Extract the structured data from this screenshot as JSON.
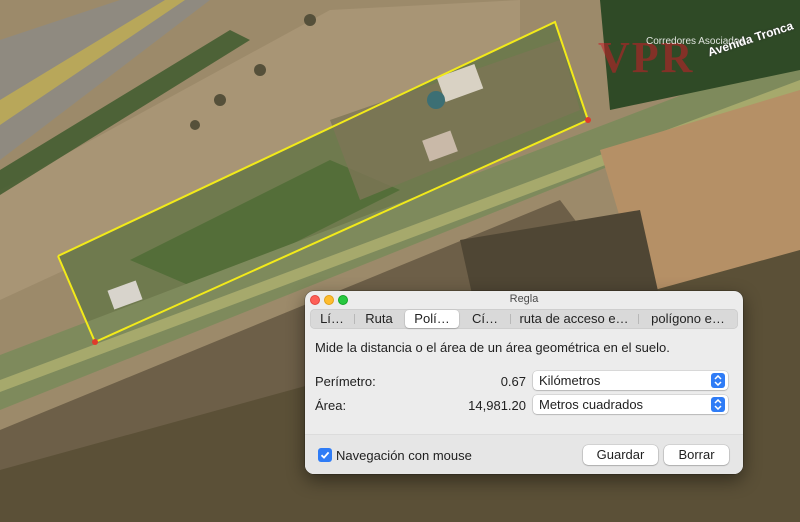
{
  "map": {
    "watermark_logo": "VPR",
    "watermark_text": "Corredores Asociados",
    "road_label": "Avenida Tronca"
  },
  "window": {
    "title": "Regla",
    "tabs": [
      {
        "label": "Lí…",
        "active": false
      },
      {
        "label": "Ruta",
        "active": false
      },
      {
        "label": "Polí…",
        "active": true
      },
      {
        "label": "Cí…",
        "active": false
      },
      {
        "label": "ruta de acceso e…",
        "active": false
      },
      {
        "label": "polígono e…",
        "active": false
      }
    ],
    "description": "Mide la distancia o el área de un área geométrica en el suelo.",
    "perimeter": {
      "label": "Perímetro:",
      "value": "0.67",
      "unit": "Kilómetros"
    },
    "area": {
      "label": "Área:",
      "value": "14,981.20",
      "unit": "Metros cuadrados"
    },
    "mouse_nav": {
      "label": "Navegación con mouse",
      "checked": true
    },
    "save_label": "Guardar",
    "clear_label": "Borrar"
  },
  "colors": {
    "polygon_outline": "#f2ea1a",
    "accent": "#2f7cf6",
    "window_bg": "#ececec"
  }
}
